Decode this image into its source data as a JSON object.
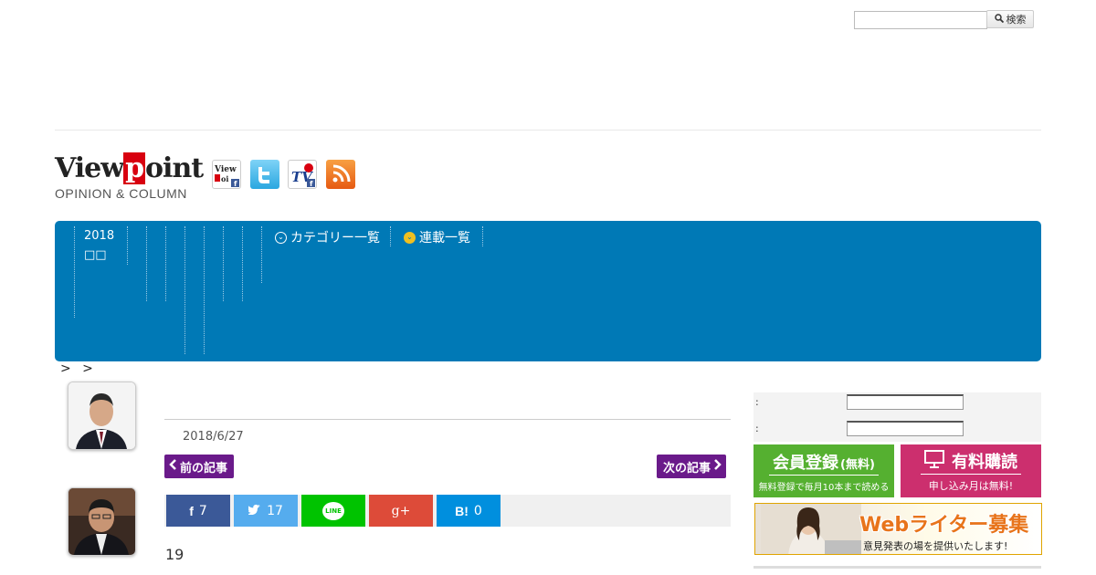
{
  "search": {
    "placeholder": "",
    "button_label": "検索"
  },
  "logo": {
    "main_before": "View",
    "main_p": "p",
    "main_after": "oint",
    "sub": "OPINION & COLUMN"
  },
  "social_icons": [
    "viewpoint-facebook-icon",
    "twitter-icon",
    "viewpoint-tv-icon",
    "rss-icon"
  ],
  "colors": {
    "nav": "#0079b6",
    "pager": "#6a1a8a",
    "facebook": "#3b5998",
    "twitter": "#55acee",
    "line": "#00c300",
    "gplus": "#dd4b39",
    "hatena": "#008fde",
    "member": "#55b030",
    "paid": "#cc2f6e"
  },
  "nav": {
    "year": "2018",
    "sub": "□□",
    "categories_label": "カテゴリー一覧",
    "series_label": "連載一覧"
  },
  "breadcrumb": "> >",
  "article": {
    "date": "2018/6/27",
    "prev_label": "前の記事",
    "next_label": "次の記事",
    "body_start": "19"
  },
  "share": {
    "facebook_count": "7",
    "twitter_count": "17",
    "line_label": "LINE",
    "gplus_label": "g+",
    "hatena_label": "B!",
    "hatena_count": "0"
  },
  "sidebar": {
    "login_label_1": ":",
    "login_label_2": ":",
    "member_title": "会員登録",
    "member_title_suffix": "(無料)",
    "member_sub": "無料登録で毎月10本まで読める",
    "paid_title": "有料購読",
    "paid_sub": "申し込み月は無料!",
    "writer_title": "Webライター募集",
    "writer_sub": "意見発表の場を提供いたします!"
  }
}
